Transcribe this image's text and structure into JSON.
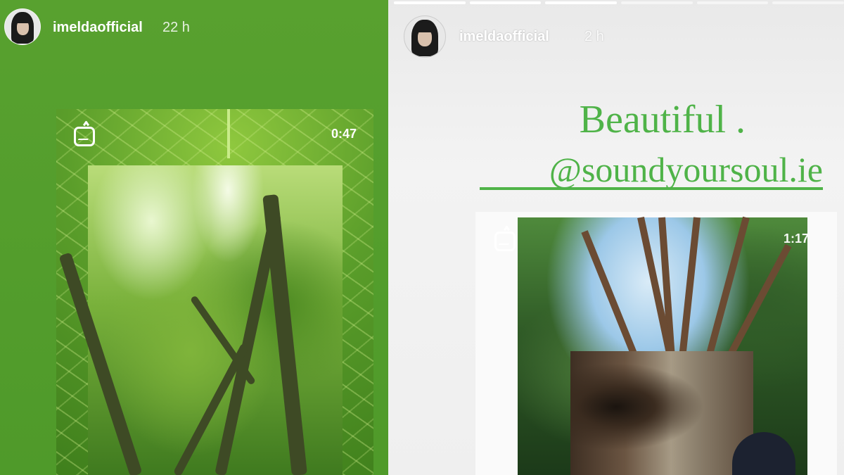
{
  "left_story": {
    "username": "imeldaofficial",
    "timestamp": "22 h",
    "video": {
      "icon": "igtv-icon",
      "duration": "0:47"
    }
  },
  "right_story": {
    "username": "imeldaofficial",
    "timestamp": "2 h",
    "progress": [
      1,
      1,
      1,
      0,
      0,
      0
    ],
    "headline_line1": "Beautiful .",
    "headline_line2": "@soundyoursoul.ie",
    "video": {
      "icon": "igtv-icon",
      "duration": "1:17"
    }
  },
  "colors": {
    "left_background": "#58a12f",
    "headline_green": "#4fb348",
    "right_background": "#efefef"
  }
}
